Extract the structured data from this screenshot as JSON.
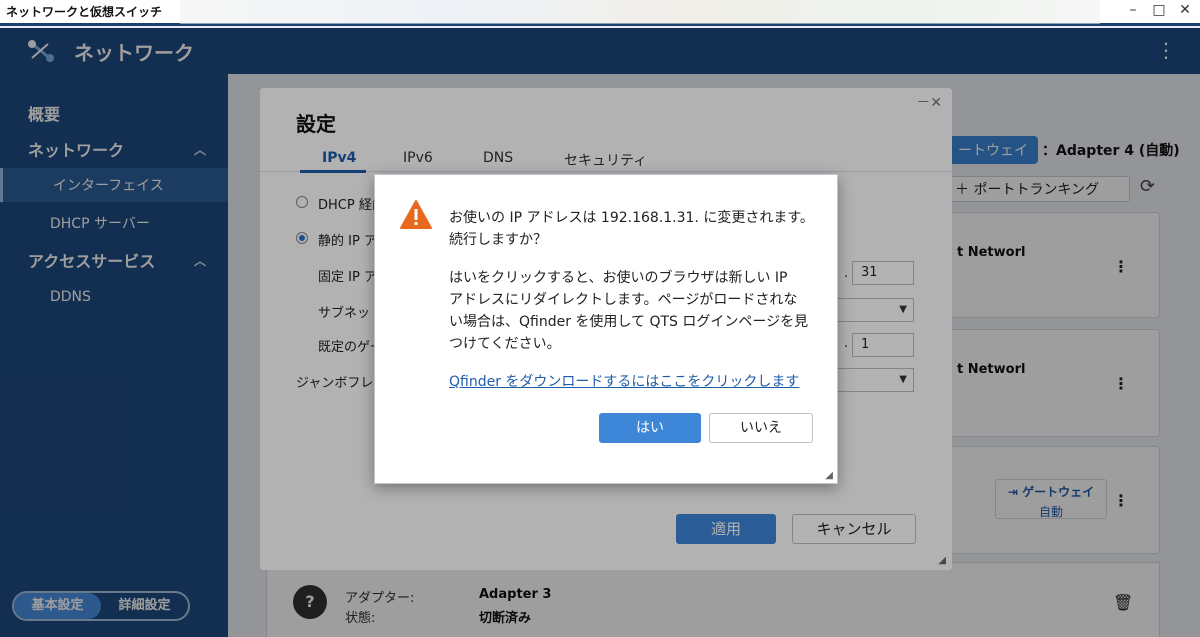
{
  "window": {
    "title": "ネットワークと仮想スイッチ",
    "minimize": "–",
    "maximize": "□",
    "close": "✕"
  },
  "app": {
    "title": "ネットワーク",
    "menu_icon": "⋮"
  },
  "sidebar": {
    "items": [
      {
        "label": "概要"
      },
      {
        "label": "ネットワーク"
      },
      {
        "label": "インターフェイス"
      },
      {
        "label": "DHCP サーバー"
      },
      {
        "label": "アクセスサービス"
      },
      {
        "label": "DDNS"
      }
    ],
    "mode_basic": "基本設定",
    "mode_advanced": "詳細設定"
  },
  "main": {
    "gateway_button": "ートウェイ",
    "adapter_label": "：Adapter 4 (自動)",
    "trunking_button": "＋ ポートトランキング",
    "card1_network": "t Networl",
    "card2_network": "t Networl",
    "card3_gateway": "ゲートウェイ",
    "card3_mode": "自動",
    "adapter3": {
      "adapter_label": "アダプター:",
      "adapter_value": "Adapter 3",
      "status_label": "状態:",
      "status_value": "切断済み"
    }
  },
  "settings": {
    "title": "設定",
    "window_controls": "－✕",
    "tabs": [
      "IPv4",
      "IPv6",
      "DNS",
      "セキュリティ"
    ],
    "dhcp_label": "DHCP 経由",
    "static_label": "静的 IP ア",
    "fixed_ip_label": "固定 IP ア",
    "fixed_ip_last": "31",
    "subnet_label": "サブネッ",
    "gateway_label": "既定のゲー",
    "gateway_last": "1",
    "jumbo_label": "ジャンボフレー",
    "dot1": ".",
    "dot2": ".",
    "apply": "適用",
    "cancel": "キャンセル"
  },
  "confirm": {
    "line1": "お使いの IP アドレスは 192.168.1.31. に変更されます。",
    "line2": "続行しますか？",
    "p2_line1": "はいをクリックすると、お使いのブラウザは新しい IP",
    "p2_line2": "アドレスにリダイレクトします。ページがロードされな",
    "p2_line3": "い場合は、Qfinder を使用して QTS ログインページを見",
    "p2_line4": "つけてください。",
    "link": "Qfinder をダウンロードするにはここをクリックします",
    "yes": "はい",
    "no": "いいえ"
  },
  "colors": {
    "accent": "#3d86d8",
    "sidebar": "#1e4b82",
    "warning": "#e8691e"
  }
}
